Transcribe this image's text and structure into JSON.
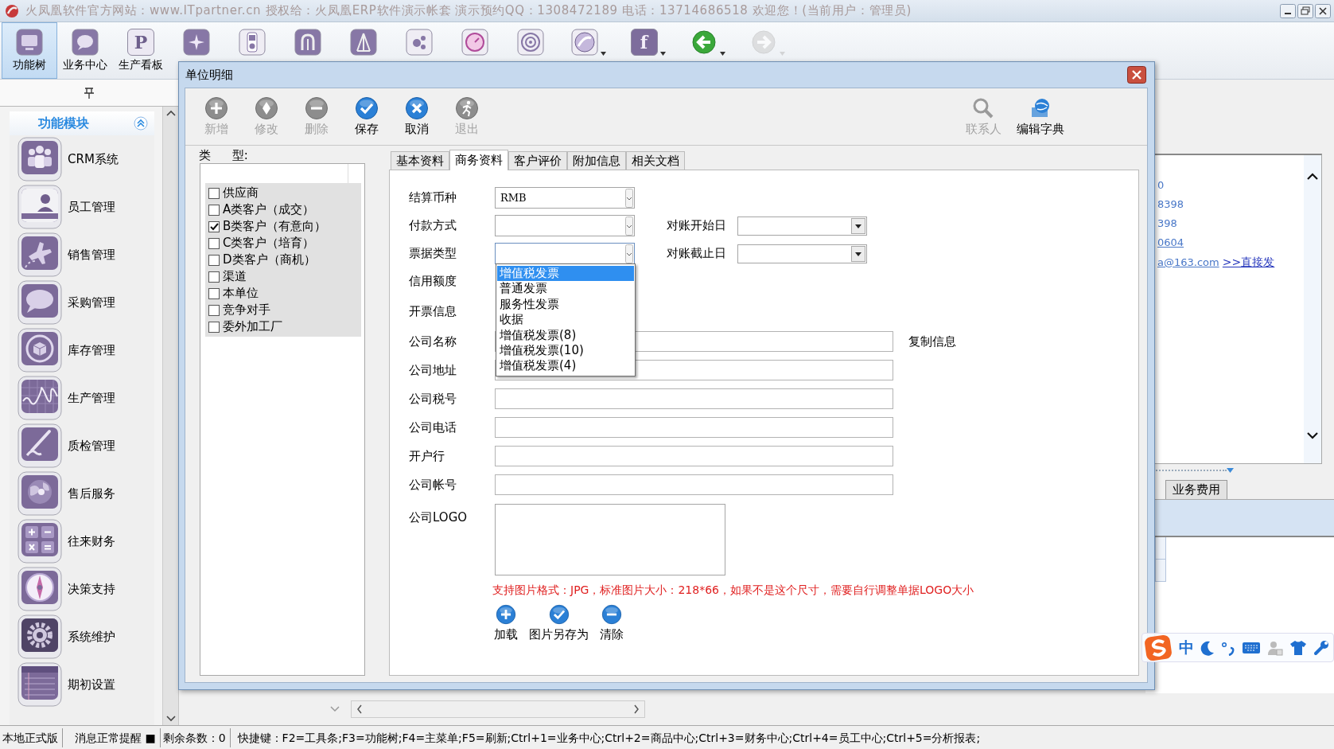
{
  "window": {
    "title": "火凤凰软件官方网站：www.ITpartner.cn  授权给：火凤凰ERP软件演示帐套 演示预约QQ：1308472189  电话：13714686518  欢迎您！(当前用户：管理员)"
  },
  "toolbar": {
    "items": [
      {
        "label": "功能树",
        "kind": "button",
        "selected": true,
        "disabled": false
      },
      {
        "label": "业务中心",
        "kind": "button",
        "selected": false,
        "disabled": false
      },
      {
        "label": "生产看板",
        "kind": "button",
        "glyph": "P",
        "selected": false,
        "disabled": false
      },
      {
        "kind": "button",
        "selected": false,
        "disabled": false
      },
      {
        "kind": "button",
        "selected": false,
        "disabled": false
      },
      {
        "kind": "button",
        "selected": false,
        "disabled": false
      },
      {
        "kind": "button",
        "selected": false,
        "disabled": false
      },
      {
        "kind": "button",
        "selected": false,
        "disabled": false
      },
      {
        "kind": "button",
        "selected": false,
        "disabled": false
      },
      {
        "kind": "button",
        "selected": false,
        "disabled": false
      },
      {
        "kind": "dropdown",
        "selected": false,
        "disabled": false
      },
      {
        "kind": "dropdown",
        "glyph": "f",
        "selected": false,
        "disabled": false
      },
      {
        "kind": "dropdown",
        "selected": false,
        "disabled": false
      },
      {
        "kind": "dropdown",
        "selected": false,
        "disabled": true
      }
    ]
  },
  "sidebar": {
    "header": "功能模块",
    "items": [
      {
        "label": "CRM系统"
      },
      {
        "label": "员工管理"
      },
      {
        "label": "销售管理"
      },
      {
        "label": "采购管理"
      },
      {
        "label": "库存管理"
      },
      {
        "label": "生产管理"
      },
      {
        "label": "质检管理"
      },
      {
        "label": "售后服务"
      },
      {
        "label": "往来财务"
      },
      {
        "label": "决策支持"
      },
      {
        "label": "系统维护"
      },
      {
        "label": "期初设置"
      }
    ]
  },
  "dialog": {
    "title": "单位明细",
    "toolbar": [
      {
        "label": "新增",
        "disabled": true
      },
      {
        "label": "修改",
        "disabled": true
      },
      {
        "label": "删除",
        "disabled": true
      },
      {
        "label": "保存",
        "disabled": false
      },
      {
        "label": "取消",
        "disabled": false
      },
      {
        "label": "退出",
        "disabled": true
      }
    ],
    "right_tools": [
      {
        "label": "联系人",
        "disabled": true
      },
      {
        "label": "编辑字典",
        "disabled": false
      }
    ],
    "types": {
      "legend": "类 型:",
      "items": [
        {
          "label": "供应商",
          "checked": false
        },
        {
          "label": "A类客户（成交）",
          "checked": false
        },
        {
          "label": "B类客户（有意向）",
          "checked": true
        },
        {
          "label": "C类客户（培育）",
          "checked": false
        },
        {
          "label": "D类客户（商机）",
          "checked": false
        },
        {
          "label": "渠道",
          "checked": false
        },
        {
          "label": "本单位",
          "checked": false
        },
        {
          "label": "竞争对手",
          "checked": false
        },
        {
          "label": "委外加工厂",
          "checked": false
        }
      ]
    },
    "tabs": [
      {
        "label": "基本资料",
        "selected": false
      },
      {
        "label": "商务资料",
        "selected": true
      },
      {
        "label": "客户评价",
        "selected": false
      },
      {
        "label": "附加信息",
        "selected": false
      },
      {
        "label": "相关文档",
        "selected": false
      }
    ],
    "form": {
      "fields": [
        {
          "label": "结算币种",
          "kind": "combo",
          "value": "RMB"
        },
        {
          "label": "付款方式",
          "kind": "combo",
          "side": {
            "label": "对账开始日"
          }
        },
        {
          "label": "票据类型",
          "kind": "combo",
          "open": true,
          "side": {
            "label": "对账截止日"
          }
        },
        {
          "label": "信用额度",
          "kind": "none"
        },
        {
          "label": "开票信息",
          "kind": "section"
        },
        {
          "label": "公司名称",
          "kind": "text",
          "action": "复制信息"
        },
        {
          "label": "公司地址",
          "kind": "text"
        },
        {
          "label": "公司税号",
          "kind": "text"
        },
        {
          "label": "公司电话",
          "kind": "text"
        },
        {
          "label": "开户行",
          "kind": "text"
        },
        {
          "label": "公司帐号",
          "kind": "text"
        }
      ],
      "dropdown": {
        "options": [
          {
            "label": "增值税发票",
            "selected": true
          },
          {
            "label": "普通发票",
            "selected": false
          },
          {
            "label": "服务性发票",
            "selected": false
          },
          {
            "label": "收据",
            "selected": false
          },
          {
            "label": "增值税发票(8)",
            "selected": false
          },
          {
            "label": "增值税发票(10)",
            "selected": false
          },
          {
            "label": "增值税发票(4)",
            "selected": false
          }
        ]
      },
      "logo": {
        "label": "公司LOGO"
      },
      "note": "支持图片格式：JPG，标准图片大小：218*66，如果不是这个尺寸，需要自行调整单据LOGO大小",
      "logo_buttons": [
        {
          "label": "加载"
        },
        {
          "label": "图片另存为"
        },
        {
          "label": "清除"
        }
      ]
    }
  },
  "info_panel": {
    "lines": [
      {
        "kind": "text",
        "text": "0"
      },
      {
        "kind": "text",
        "text": "8398"
      },
      {
        "kind": "text",
        "text": "398"
      },
      {
        "kind": "link",
        "text": "0604"
      },
      {
        "kind": "email",
        "text": "a@163.com",
        "link": ">>直接发"
      }
    ]
  },
  "bottom_tabs": [
    {
      "label": "业务费用",
      "selected": false
    }
  ],
  "ime": {
    "mode": "中"
  },
  "status_bar": {
    "cells": [
      "本地正式版",
      "消息正常提醒 ■",
      "剩余条数：0",
      "快捷键：F2=工具条;F3=功能树;F4=主菜单;F5=刷新;Ctrl+1=业务中心;Ctrl+2=商品中心;Ctrl+3=财务中心;Ctrl+4=员工中心;Ctrl+5=分析报表;"
    ]
  }
}
